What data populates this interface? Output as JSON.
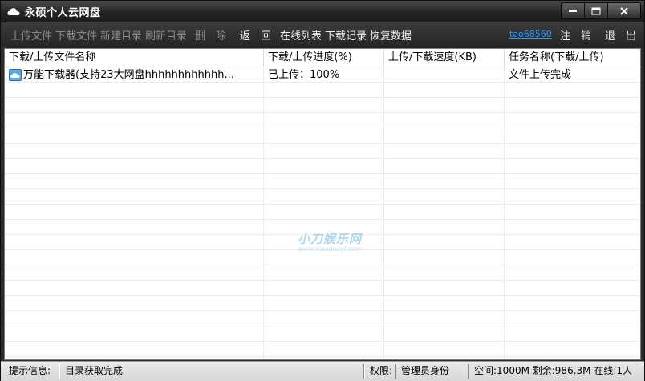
{
  "window": {
    "title": "永硕个人云网盘",
    "icon": "cloud-icon"
  },
  "menu": {
    "items": [
      {
        "label": "上传文件",
        "enabled": false
      },
      {
        "label": "下载文件",
        "enabled": false
      },
      {
        "label": "新建目录",
        "enabled": false
      },
      {
        "label": "刷新目录",
        "enabled": false
      },
      {
        "label": "删　除",
        "enabled": false
      },
      {
        "label": "返　回",
        "enabled": true
      },
      {
        "label": "在线列表",
        "enabled": true
      },
      {
        "label": "下载记录",
        "enabled": true
      },
      {
        "label": "恢复数据",
        "enabled": true
      }
    ],
    "username": "tao68560",
    "logout": "注　销",
    "exit": "退　出"
  },
  "table": {
    "columns": [
      "下载/上传文件名称",
      "下载/上传进度(%)",
      "上传/下载速度(KB)",
      "任务名称(下载/上传)"
    ],
    "rows": [
      {
        "name": "万能下载器(支持23大网盘hhhhhhhhhhhh...",
        "progress": "已上传：100%",
        "speed": "",
        "task": "文件上传完成",
        "icon": "cloud-file-icon"
      }
    ]
  },
  "watermark": {
    "main": "小刀娱乐网",
    "sub": "www.xiaodaoyl.com"
  },
  "status": {
    "hint_label": "提示信息:",
    "hint_value": "目录获取完成",
    "perm_label": "权限:",
    "perm_value": "管理员身份",
    "space": "空间:1000M 剩余:986.3M 在线:1人"
  },
  "colors": {
    "titlebar": "#2a2a2a",
    "link": "#2a9cff",
    "disabled_text": "#8c8c8c"
  }
}
